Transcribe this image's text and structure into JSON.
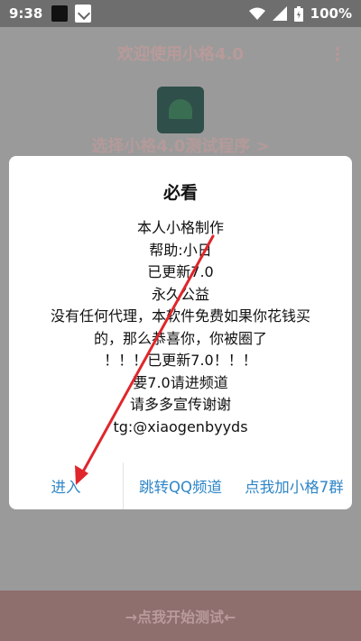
{
  "status_bar": {
    "time": "9:38",
    "battery_percent": "100%",
    "icons": [
      "notification-icon",
      "app-store-icon",
      "wifi-icon",
      "signal-icon",
      "battery-icon"
    ]
  },
  "background_app": {
    "title": "欢迎使用小格4.0",
    "select_text": "选择小格4.0测试程序 >",
    "start_button": "→点我开始测试←"
  },
  "dialog": {
    "title": "必看",
    "lines": [
      "本人小格制作",
      "帮助:小日",
      "已更新7.0",
      "永久公益",
      "没有任何代理，本软件免费如果你花钱买",
      "的，那么恭喜你，你被圈了",
      "！！！已更新7.0！！！",
      "要7.0请进频道",
      "请多多宣传谢谢",
      "tg:@xiaogenbyyds"
    ],
    "buttons": {
      "enter": "进入",
      "qq_channel": "跳转QQ频道",
      "add_friend": "点我加小格7群"
    }
  },
  "colors": {
    "accent": "#2f86c7",
    "annotation_arrow": "#e0262b",
    "scrim": "#8a8a8a"
  }
}
